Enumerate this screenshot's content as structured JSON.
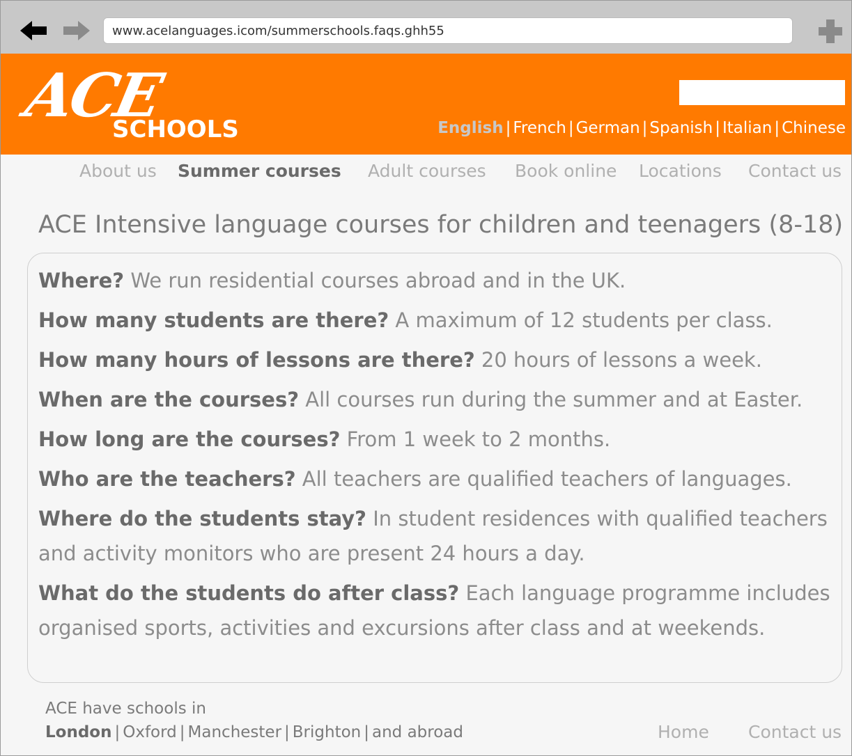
{
  "browser": {
    "url": "www.acelanguages.icom/summerschools.faqs.ghh55",
    "back_icon": "back-arrow-icon",
    "forward_icon": "forward-arrow-icon",
    "plus_icon": "plus-icon"
  },
  "header": {
    "logo_ace": "ACE",
    "logo_schools": "SCHOOLS",
    "search_value": "",
    "languages": [
      "English",
      "French",
      "German",
      "Spanish",
      "Italian",
      "Chinese"
    ],
    "active_language": "English",
    "separator": "|"
  },
  "nav": {
    "items": [
      "About us",
      "Summer courses",
      "Adult courses",
      "Book online",
      "Locations",
      "Contact us"
    ],
    "active": "Summer courses"
  },
  "page_title": "ACE Intensive language courses for children and teenagers (8-18)",
  "faq": [
    {
      "q": "Where?",
      "a": "We run residential courses abroad and in the UK."
    },
    {
      "q": "How many students are there?",
      "a": "A maximum of 12 students per class."
    },
    {
      "q": "How many hours of lessons are there?",
      "a": "20 hours of lessons a week."
    },
    {
      "q": "When are the courses?",
      "a": "All courses run during the summer and at Easter."
    },
    {
      "q": "How long are the courses?",
      "a": "From 1 week to 2 months."
    },
    {
      "q": "Who are the teachers?",
      "a": "All teachers are qualified teachers of languages."
    },
    {
      "q": "Where do the students stay?",
      "a": "In student residences with qualified teachers and activity monitors who are present 24 hours a day."
    },
    {
      "q": "What do the students do after class?",
      "a": "Each language programme includes organised sports, activities and excursions after class and at weekends."
    }
  ],
  "footer": {
    "intro": "ACE have schools in",
    "cities": [
      "London",
      "Oxford",
      "Manchester",
      "Brighton",
      "and abroad"
    ],
    "active_city": "London",
    "home": "Home",
    "contact": "Contact us"
  },
  "colors": {
    "brand_orange": "#ff7a00",
    "browser_chrome": "#c8c8c8",
    "page_bg": "#f6f6f6"
  }
}
